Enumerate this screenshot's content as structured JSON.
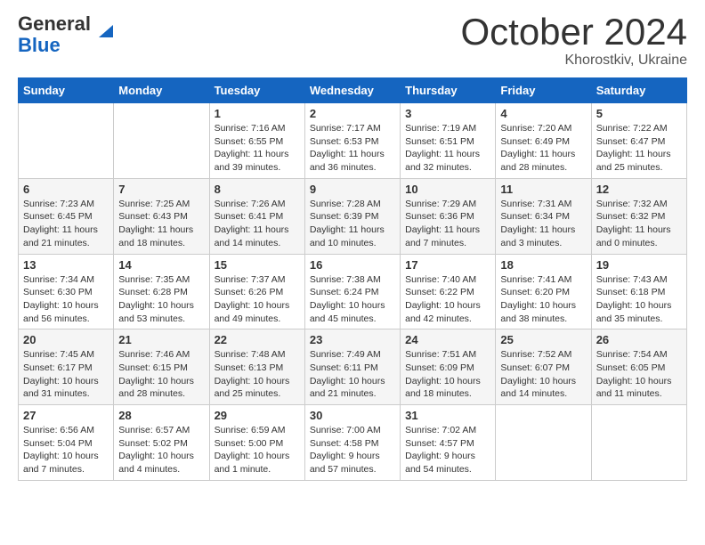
{
  "header": {
    "logo_general": "General",
    "logo_blue": "Blue",
    "month_title": "October 2024",
    "location": "Khorostkiv, Ukraine"
  },
  "weekdays": [
    "Sunday",
    "Monday",
    "Tuesday",
    "Wednesday",
    "Thursday",
    "Friday",
    "Saturday"
  ],
  "weeks": [
    [
      {
        "day": "",
        "sunrise": "",
        "sunset": "",
        "daylight": ""
      },
      {
        "day": "",
        "sunrise": "",
        "sunset": "",
        "daylight": ""
      },
      {
        "day": "1",
        "sunrise": "Sunrise: 7:16 AM",
        "sunset": "Sunset: 6:55 PM",
        "daylight": "Daylight: 11 hours and 39 minutes."
      },
      {
        "day": "2",
        "sunrise": "Sunrise: 7:17 AM",
        "sunset": "Sunset: 6:53 PM",
        "daylight": "Daylight: 11 hours and 36 minutes."
      },
      {
        "day": "3",
        "sunrise": "Sunrise: 7:19 AM",
        "sunset": "Sunset: 6:51 PM",
        "daylight": "Daylight: 11 hours and 32 minutes."
      },
      {
        "day": "4",
        "sunrise": "Sunrise: 7:20 AM",
        "sunset": "Sunset: 6:49 PM",
        "daylight": "Daylight: 11 hours and 28 minutes."
      },
      {
        "day": "5",
        "sunrise": "Sunrise: 7:22 AM",
        "sunset": "Sunset: 6:47 PM",
        "daylight": "Daylight: 11 hours and 25 minutes."
      }
    ],
    [
      {
        "day": "6",
        "sunrise": "Sunrise: 7:23 AM",
        "sunset": "Sunset: 6:45 PM",
        "daylight": "Daylight: 11 hours and 21 minutes."
      },
      {
        "day": "7",
        "sunrise": "Sunrise: 7:25 AM",
        "sunset": "Sunset: 6:43 PM",
        "daylight": "Daylight: 11 hours and 18 minutes."
      },
      {
        "day": "8",
        "sunrise": "Sunrise: 7:26 AM",
        "sunset": "Sunset: 6:41 PM",
        "daylight": "Daylight: 11 hours and 14 minutes."
      },
      {
        "day": "9",
        "sunrise": "Sunrise: 7:28 AM",
        "sunset": "Sunset: 6:39 PM",
        "daylight": "Daylight: 11 hours and 10 minutes."
      },
      {
        "day": "10",
        "sunrise": "Sunrise: 7:29 AM",
        "sunset": "Sunset: 6:36 PM",
        "daylight": "Daylight: 11 hours and 7 minutes."
      },
      {
        "day": "11",
        "sunrise": "Sunrise: 7:31 AM",
        "sunset": "Sunset: 6:34 PM",
        "daylight": "Daylight: 11 hours and 3 minutes."
      },
      {
        "day": "12",
        "sunrise": "Sunrise: 7:32 AM",
        "sunset": "Sunset: 6:32 PM",
        "daylight": "Daylight: 11 hours and 0 minutes."
      }
    ],
    [
      {
        "day": "13",
        "sunrise": "Sunrise: 7:34 AM",
        "sunset": "Sunset: 6:30 PM",
        "daylight": "Daylight: 10 hours and 56 minutes."
      },
      {
        "day": "14",
        "sunrise": "Sunrise: 7:35 AM",
        "sunset": "Sunset: 6:28 PM",
        "daylight": "Daylight: 10 hours and 53 minutes."
      },
      {
        "day": "15",
        "sunrise": "Sunrise: 7:37 AM",
        "sunset": "Sunset: 6:26 PM",
        "daylight": "Daylight: 10 hours and 49 minutes."
      },
      {
        "day": "16",
        "sunrise": "Sunrise: 7:38 AM",
        "sunset": "Sunset: 6:24 PM",
        "daylight": "Daylight: 10 hours and 45 minutes."
      },
      {
        "day": "17",
        "sunrise": "Sunrise: 7:40 AM",
        "sunset": "Sunset: 6:22 PM",
        "daylight": "Daylight: 10 hours and 42 minutes."
      },
      {
        "day": "18",
        "sunrise": "Sunrise: 7:41 AM",
        "sunset": "Sunset: 6:20 PM",
        "daylight": "Daylight: 10 hours and 38 minutes."
      },
      {
        "day": "19",
        "sunrise": "Sunrise: 7:43 AM",
        "sunset": "Sunset: 6:18 PM",
        "daylight": "Daylight: 10 hours and 35 minutes."
      }
    ],
    [
      {
        "day": "20",
        "sunrise": "Sunrise: 7:45 AM",
        "sunset": "Sunset: 6:17 PM",
        "daylight": "Daylight: 10 hours and 31 minutes."
      },
      {
        "day": "21",
        "sunrise": "Sunrise: 7:46 AM",
        "sunset": "Sunset: 6:15 PM",
        "daylight": "Daylight: 10 hours and 28 minutes."
      },
      {
        "day": "22",
        "sunrise": "Sunrise: 7:48 AM",
        "sunset": "Sunset: 6:13 PM",
        "daylight": "Daylight: 10 hours and 25 minutes."
      },
      {
        "day": "23",
        "sunrise": "Sunrise: 7:49 AM",
        "sunset": "Sunset: 6:11 PM",
        "daylight": "Daylight: 10 hours and 21 minutes."
      },
      {
        "day": "24",
        "sunrise": "Sunrise: 7:51 AM",
        "sunset": "Sunset: 6:09 PM",
        "daylight": "Daylight: 10 hours and 18 minutes."
      },
      {
        "day": "25",
        "sunrise": "Sunrise: 7:52 AM",
        "sunset": "Sunset: 6:07 PM",
        "daylight": "Daylight: 10 hours and 14 minutes."
      },
      {
        "day": "26",
        "sunrise": "Sunrise: 7:54 AM",
        "sunset": "Sunset: 6:05 PM",
        "daylight": "Daylight: 10 hours and 11 minutes."
      }
    ],
    [
      {
        "day": "27",
        "sunrise": "Sunrise: 6:56 AM",
        "sunset": "Sunset: 5:04 PM",
        "daylight": "Daylight: 10 hours and 7 minutes."
      },
      {
        "day": "28",
        "sunrise": "Sunrise: 6:57 AM",
        "sunset": "Sunset: 5:02 PM",
        "daylight": "Daylight: 10 hours and 4 minutes."
      },
      {
        "day": "29",
        "sunrise": "Sunrise: 6:59 AM",
        "sunset": "Sunset: 5:00 PM",
        "daylight": "Daylight: 10 hours and 1 minute."
      },
      {
        "day": "30",
        "sunrise": "Sunrise: 7:00 AM",
        "sunset": "Sunset: 4:58 PM",
        "daylight": "Daylight: 9 hours and 57 minutes."
      },
      {
        "day": "31",
        "sunrise": "Sunrise: 7:02 AM",
        "sunset": "Sunset: 4:57 PM",
        "daylight": "Daylight: 9 hours and 54 minutes."
      },
      {
        "day": "",
        "sunrise": "",
        "sunset": "",
        "daylight": ""
      },
      {
        "day": "",
        "sunrise": "",
        "sunset": "",
        "daylight": ""
      }
    ]
  ]
}
